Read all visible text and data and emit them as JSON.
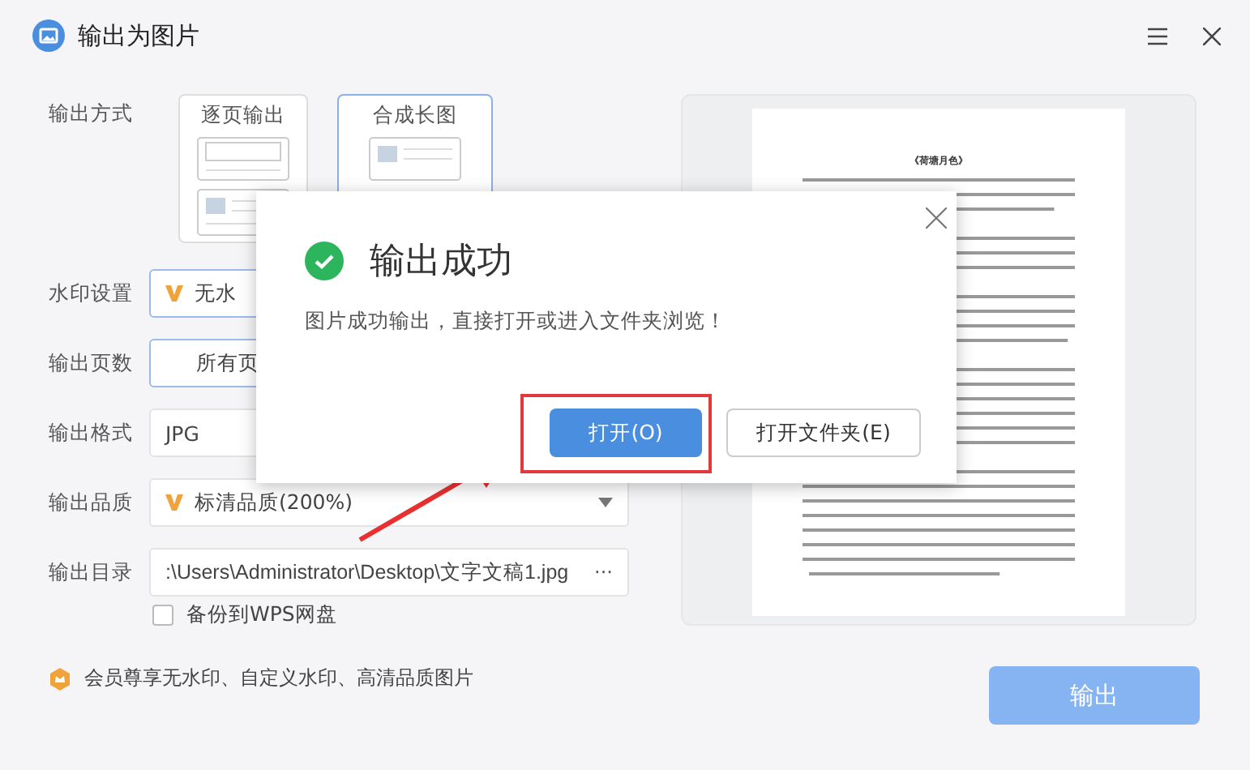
{
  "window": {
    "title": "输出为图片"
  },
  "form": {
    "mode": {
      "label": "输出方式",
      "options": [
        {
          "label": "逐页输出",
          "selected": false
        },
        {
          "label": "合成长图",
          "selected": true
        }
      ]
    },
    "watermark": {
      "label": "水印设置",
      "value": "无水"
    },
    "pages": {
      "label": "输出页数",
      "value": "所有页"
    },
    "format": {
      "label": "输出格式",
      "value": "JPG"
    },
    "quality": {
      "label": "输出品质",
      "value": "标清品质(200%)"
    },
    "directory": {
      "label": "输出目录",
      "value": ":\\Users\\Administrator\\Desktop\\文字文稿1.jpg",
      "browse": "···"
    },
    "backup": {
      "label": "备份到WPS网盘",
      "checked": false
    },
    "member_note": "会员尊享无水印、自定义水印、高清品质图片"
  },
  "preview": {
    "doc_title": "《荷塘月色》"
  },
  "output_button": "输出",
  "dialog": {
    "title": "输出成功",
    "message": "图片成功输出，直接打开或进入文件夹浏览！",
    "buttons": [
      {
        "label": "打开(O)",
        "kind": "primary",
        "highlighted": true
      },
      {
        "label": "打开文件夹(E)",
        "kind": "secondary",
        "highlighted": false
      }
    ]
  }
}
